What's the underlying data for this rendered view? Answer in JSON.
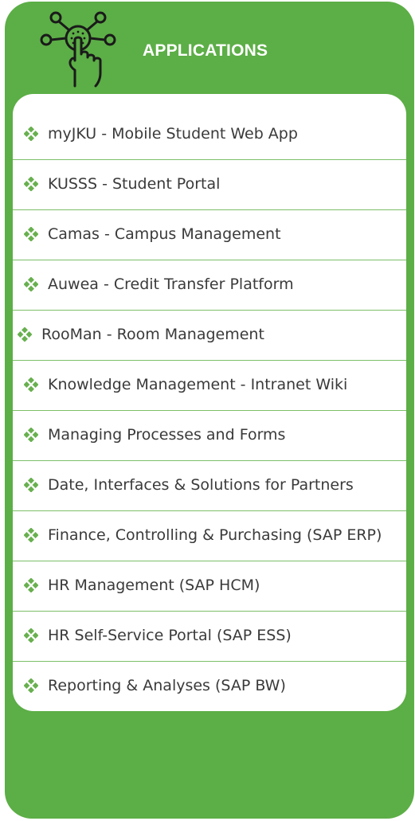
{
  "header": {
    "title": "APPLICATIONS",
    "icon": "touch-network-icon"
  },
  "colors": {
    "brand_green": "#5cae46",
    "bullet_green": "#68b04f",
    "text": "#3a3a3a"
  },
  "list": {
    "bullet_icon": "diamond-bullet-icon",
    "items": [
      {
        "label": "myJKU - Mobile Student Web App"
      },
      {
        "label": "KUSSS - Student Portal"
      },
      {
        "label": "Camas - Campus Management"
      },
      {
        "label": "Auwea - Credit Transfer Platform"
      },
      {
        "label": "RooMan - Room Management"
      },
      {
        "label": "Knowledge Management - Intranet Wiki"
      },
      {
        "label": "Managing Processes and Forms"
      },
      {
        "label": "Date, Interfaces & Solutions for Partners"
      },
      {
        "label": "Finance, Controlling & Purchasing (SAP ERP)"
      },
      {
        "label": "HR Management (SAP HCM)"
      },
      {
        "label": "HR Self-Service Portal (SAP ESS)"
      },
      {
        "label": "Reporting & Analyses (SAP BW)"
      }
    ]
  }
}
